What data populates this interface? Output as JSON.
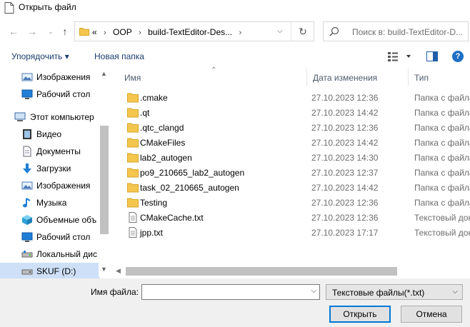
{
  "window": {
    "title": "Открыть файл"
  },
  "address": {
    "overflow": "«",
    "crumbs": [
      "OOP",
      "build-TextEditor-Des..."
    ],
    "search_placeholder": "Поиск в: build-TextEditor-D..."
  },
  "toolbar": {
    "organize": "Упорядочить ▾",
    "new_folder": "Новая папка"
  },
  "nav": [
    {
      "label": "Изображения",
      "icon": "pictures-icon"
    },
    {
      "label": "Рабочий стол",
      "icon": "desktop-icon"
    },
    {
      "label": "Этот компьютер",
      "icon": "computer-icon"
    },
    {
      "label": "Видео",
      "icon": "video-icon"
    },
    {
      "label": "Документы",
      "icon": "documents-icon"
    },
    {
      "label": "Загрузки",
      "icon": "downloads-icon"
    },
    {
      "label": "Изображения",
      "icon": "pictures-icon"
    },
    {
      "label": "Музыка",
      "icon": "music-icon"
    },
    {
      "label": "Объемные объ",
      "icon": "3d-objects-icon"
    },
    {
      "label": "Рабочий стол",
      "icon": "desktop-icon"
    },
    {
      "label": "Локальный дис",
      "icon": "drive-icon"
    },
    {
      "label": "SKUF (D:)",
      "icon": "drive-icon"
    }
  ],
  "columns": {
    "name": "Имя",
    "date": "Дата изменения",
    "type": "Тип"
  },
  "files": [
    {
      "name": ".cmake",
      "date": "27.10.2023 12:36",
      "type": "Папка с файла",
      "kind": "folder"
    },
    {
      "name": ".qt",
      "date": "27.10.2023 14:42",
      "type": "Папка с файла",
      "kind": "folder"
    },
    {
      "name": ".qtc_clangd",
      "date": "27.10.2023 12:36",
      "type": "Папка с файла",
      "kind": "folder"
    },
    {
      "name": "CMakeFiles",
      "date": "27.10.2023 14:42",
      "type": "Папка с файла",
      "kind": "folder"
    },
    {
      "name": "lab2_autogen",
      "date": "27.10.2023 14:30",
      "type": "Папка с файла",
      "kind": "folder"
    },
    {
      "name": "po9_210665_lab2_autogen",
      "date": "27.10.2023 12:37",
      "type": "Папка с файла",
      "kind": "folder"
    },
    {
      "name": "task_02_210665_autogen",
      "date": "27.10.2023 14:42",
      "type": "Папка с файла",
      "kind": "folder"
    },
    {
      "name": "Testing",
      "date": "27.10.2023 12:36",
      "type": "Папка с файла",
      "kind": "folder"
    },
    {
      "name": "CMakeCache.txt",
      "date": "27.10.2023 12:36",
      "type": "Текстовый док",
      "kind": "text"
    },
    {
      "name": "jpp.txt",
      "date": "27.10.2023 17:17",
      "type": "Текстовый док",
      "kind": "text"
    }
  ],
  "footer": {
    "filename_label": "Имя файла:",
    "filename_value": "",
    "filter": "Текстовые файлы(*.txt)",
    "open": "Открыть",
    "cancel": "Отмена"
  },
  "colors": {
    "folder": "#f4c64e",
    "accent": "#0078d7",
    "selected": "#cde0f7"
  }
}
